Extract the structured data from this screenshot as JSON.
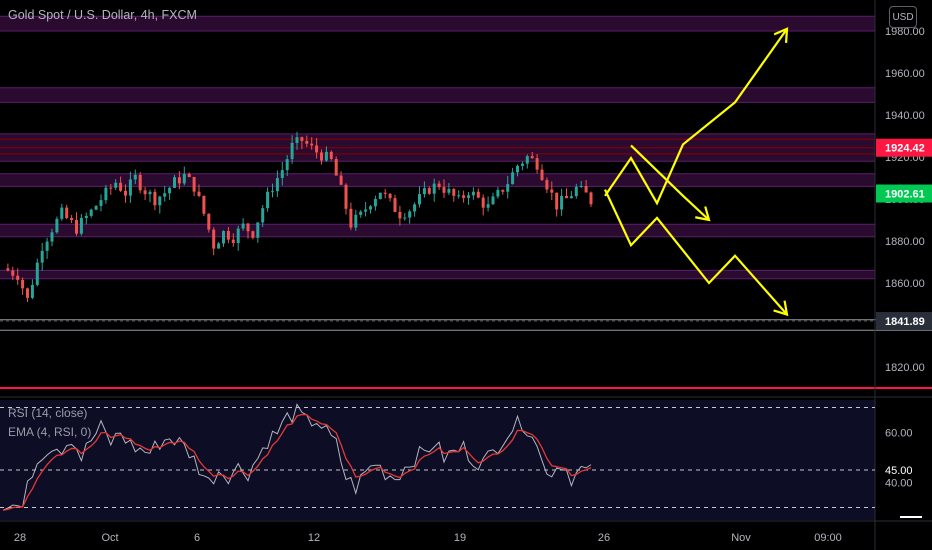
{
  "header": {
    "title": "Gold Spot / U.S. Dollar, 4h, FXCM",
    "currency_button": "USD"
  },
  "rsi_panel": {
    "rsi_label": "RSI (14, close)",
    "ema_label": "EMA (4, RSI, 0)"
  },
  "colors": {
    "background": "#000000",
    "up_candle": "#26a69a",
    "down_candle": "#ef5350",
    "zone_fill": "#2a0a2e",
    "zone_edge": "#5b1f6b",
    "red_line": "#ff1744",
    "arrows": "#ffff00",
    "rsi_bg": "#0d0d26",
    "rsi_line": "#b2b5be",
    "ema_line": "#e53935",
    "badge_red": "#ff1744",
    "badge_green": "#00c853",
    "badge_gray": "#2a2e39"
  },
  "chart_data": [
    {
      "type": "candlestick",
      "title": "Gold Spot / U.S. Dollar, 4h, FXCM",
      "x_tick_labels": [
        "28",
        "Oct",
        "6",
        "12",
        "19",
        "26",
        "Nov",
        "09:00"
      ],
      "y_ticks": [
        1820,
        1840,
        1860,
        1880,
        1900,
        1920,
        1940,
        1960,
        1980
      ],
      "y_tick_labels": [
        "1820.00",
        "1840.00",
        "1860.00",
        "1880.00",
        "1900.00",
        "1920.00",
        "1940.00",
        "1960.00",
        "1980.00"
      ],
      "ylim": [
        1807,
        1996
      ],
      "price_badges": [
        {
          "label": "1924.42",
          "value": 1924.42,
          "color": "red"
        },
        {
          "label": "1902.61",
          "value": 1902.61,
          "color": "green"
        },
        {
          "label": "1841.89",
          "value": 1841.89,
          "color": "gray"
        }
      ],
      "approx_close_path": [
        [
          0,
          1867
        ],
        [
          3,
          1864
        ],
        [
          5,
          1852
        ],
        [
          8,
          1878
        ],
        [
          10,
          1886
        ],
        [
          12,
          1893
        ],
        [
          15,
          1886
        ],
        [
          18,
          1894
        ],
        [
          20,
          1900
        ],
        [
          23,
          1908
        ],
        [
          25,
          1903
        ],
        [
          27,
          1910
        ],
        [
          29,
          1904
        ],
        [
          31,
          1900
        ],
        [
          33,
          1903
        ],
        [
          35,
          1908
        ],
        [
          37,
          1911
        ],
        [
          39,
          1906
        ],
        [
          41,
          1893
        ],
        [
          43,
          1878
        ],
        [
          45,
          1884
        ],
        [
          47,
          1882
        ],
        [
          49,
          1887
        ],
        [
          51,
          1884
        ],
        [
          53,
          1896
        ],
        [
          55,
          1906
        ],
        [
          57,
          1914
        ],
        [
          59,
          1925
        ],
        [
          61,
          1928
        ],
        [
          63,
          1924
        ],
        [
          65,
          1921
        ],
        [
          67,
          1918
        ],
        [
          69,
          1904
        ],
        [
          71,
          1888
        ],
        [
          73,
          1892
        ],
        [
          75,
          1899
        ],
        [
          77,
          1904
        ],
        [
          79,
          1898
        ],
        [
          81,
          1893
        ],
        [
          83,
          1895
        ],
        [
          85,
          1900
        ],
        [
          87,
          1905
        ],
        [
          89,
          1907
        ],
        [
          91,
          1903
        ],
        [
          93,
          1899
        ],
        [
          95,
          1904
        ],
        [
          97,
          1900
        ],
        [
          99,
          1896
        ],
        [
          101,
          1902
        ],
        [
          103,
          1908
        ],
        [
          105,
          1916
        ],
        [
          107,
          1920
        ],
        [
          109,
          1917
        ],
        [
          111,
          1907
        ],
        [
          113,
          1897
        ],
        [
          115,
          1900
        ],
        [
          117,
          1905
        ],
        [
          119,
          1902
        ],
        [
          120,
          1899
        ]
      ],
      "horizontal_zones": [
        [
          1980,
          1987
        ],
        [
          1946,
          1953
        ],
        [
          1918,
          1931
        ],
        [
          1906,
          1912
        ],
        [
          1882,
          1888
        ],
        [
          1862,
          1866
        ]
      ],
      "horizontal_lines": [
        1842.5,
        1837.5,
        1810
      ],
      "projection_arrows": [
        [
          [
            1901.5,
            0
          ],
          [
            1919.5,
            1
          ],
          [
            1898,
            2
          ],
          [
            1926,
            3
          ],
          [
            1946,
            5
          ],
          [
            1981,
            7
          ]
        ],
        [
          [
            1925.5,
            1
          ],
          [
            1901.5,
            3
          ],
          [
            1890,
            4
          ]
        ],
        [
          [
            1904.5,
            0
          ],
          [
            1878,
            1
          ],
          [
            1891,
            2
          ],
          [
            1860,
            4
          ],
          [
            1873,
            5
          ],
          [
            1845,
            7
          ]
        ]
      ]
    },
    {
      "type": "line",
      "series": [
        {
          "name": "RSI (14, close)"
        },
        {
          "name": "EMA (4, RSI, 0)"
        }
      ],
      "y_ticks": [
        40,
        45,
        60
      ],
      "y_tick_labels": [
        "40.00",
        "60.00"
      ],
      "dashed_levels": [
        70,
        30
      ],
      "badge": {
        "label": "45.00",
        "value": 45
      },
      "approx_rsi_path": [
        [
          0,
          32
        ],
        [
          4,
          30
        ],
        [
          6,
          45
        ],
        [
          8,
          52
        ],
        [
          10,
          55
        ],
        [
          12,
          54
        ],
        [
          14,
          58
        ],
        [
          16,
          50
        ],
        [
          18,
          57
        ],
        [
          20,
          62
        ],
        [
          22,
          56
        ],
        [
          24,
          60
        ],
        [
          26,
          55
        ],
        [
          28,
          53
        ],
        [
          30,
          52
        ],
        [
          32,
          56
        ],
        [
          34,
          58
        ],
        [
          36,
          56
        ],
        [
          38,
          52
        ],
        [
          40,
          46
        ],
        [
          42,
          40
        ],
        [
          44,
          45
        ],
        [
          46,
          43
        ],
        [
          48,
          46
        ],
        [
          50,
          44
        ],
        [
          52,
          50
        ],
        [
          54,
          57
        ],
        [
          56,
          60
        ],
        [
          58,
          66
        ],
        [
          60,
          68
        ],
        [
          62,
          64
        ],
        [
          64,
          65
        ],
        [
          66,
          60
        ],
        [
          68,
          55
        ],
        [
          70,
          42
        ],
        [
          72,
          38
        ],
        [
          74,
          44
        ],
        [
          76,
          48
        ],
        [
          78,
          44
        ],
        [
          80,
          42
        ],
        [
          82,
          46
        ],
        [
          84,
          50
        ],
        [
          86,
          52
        ],
        [
          88,
          56
        ],
        [
          90,
          50
        ],
        [
          92,
          52
        ],
        [
          94,
          54
        ],
        [
          96,
          49
        ],
        [
          98,
          48
        ],
        [
          100,
          52
        ],
        [
          102,
          58
        ],
        [
          104,
          62
        ],
        [
          106,
          64
        ],
        [
          108,
          60
        ],
        [
          110,
          48
        ],
        [
          112,
          44
        ],
        [
          114,
          48
        ],
        [
          116,
          42
        ],
        [
          118,
          45
        ],
        [
          120,
          44
        ]
      ]
    }
  ]
}
